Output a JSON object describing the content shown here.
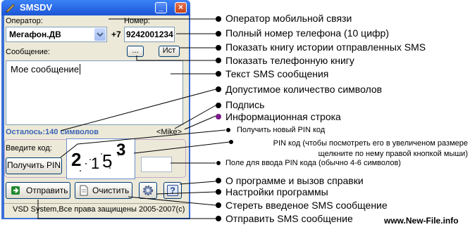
{
  "window": {
    "title": "SMSDV",
    "minimize_glyph": "_",
    "close_glyph": "×"
  },
  "form": {
    "operator_label": "Оператор:",
    "operator_value": "Мегафон.ДВ",
    "country_code": "+7",
    "phone_label": "Номер:",
    "phone_value": "9242001234",
    "phonebook_button": "...",
    "history_button": "Ист",
    "message_label": "Сообщение:",
    "message_text": "Мое сообщение",
    "remaining_text": "Осталось:140 символов",
    "signature": "<Mike>",
    "pin_label": "Введите код:",
    "captcha_glyphs": [
      "2",
      "1",
      "5",
      "3"
    ],
    "get_pin_button": "Получить PIN",
    "send_button": "Отправить",
    "clear_button": "Очистить",
    "help_button": "?",
    "settings_icon": "gear-icon",
    "status_text": "VSD System,Все права защищены 2005-2007(с)"
  },
  "annotations": {
    "operator": "Оператор мобильной связи",
    "phone": "Полный номер телефона (10 цифр)",
    "history": "Показать книгу истории отправленных SMS",
    "phonebook": "Показать телефонную книгу",
    "message": "Текст SMS сообщения",
    "chars": "Допустимое количество символов",
    "signature": "Подпись",
    "info": "Информационная строка",
    "new_pin": "Получить новый PIN код",
    "pin_desc": "PIN код (чтобы посмотреть его в увеличеном размере щелкните по нему правой кнопкой мыши)",
    "pin_field": "Поле для ввода PIN кода (обычно 4-6 символов)",
    "about": "О программе и вызов справки",
    "settings": "Настройки программы",
    "clear": "Стереть введеное SMS сообщение",
    "send": "Отправить SMS сообщение"
  },
  "watermark": "www.New-File.info",
  "colors": {
    "title_bar": "#2a64de",
    "client_bg": "#ece9d8",
    "remaining_text": "#3c64b4",
    "info_dot": "#7a1a8a"
  }
}
